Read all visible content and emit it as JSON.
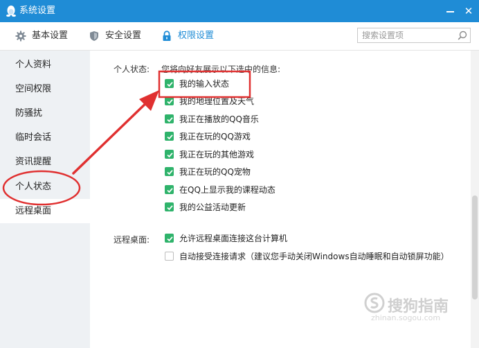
{
  "window": {
    "title": "系统设置",
    "min_icon": "minimize-icon",
    "close_glyph": "✕"
  },
  "tabs": [
    {
      "label": "基本设置",
      "icon": "gear-icon"
    },
    {
      "label": "安全设置",
      "icon": "shield-icon"
    },
    {
      "label": "权限设置",
      "icon": "lock-icon",
      "active": true
    }
  ],
  "search": {
    "placeholder": "搜索设置项",
    "value": ""
  },
  "sidebar": {
    "items": [
      {
        "label": "个人资料"
      },
      {
        "label": "空间权限"
      },
      {
        "label": "防骚扰"
      },
      {
        "label": "临时会话"
      },
      {
        "label": "资讯提醒"
      },
      {
        "label": "个人状态"
      },
      {
        "label": "远程桌面",
        "selected": true
      }
    ]
  },
  "personal_status": {
    "label": "个人状态:",
    "description": "您将向好友展示以下选中的信息:",
    "options": [
      {
        "label": "我的输入状态",
        "checked": true
      },
      {
        "label": "我的地理位置及天气",
        "checked": true
      },
      {
        "label": "我正在播放的QQ音乐",
        "checked": true
      },
      {
        "label": "我正在玩的QQ游戏",
        "checked": true
      },
      {
        "label": "我正在玩的其他游戏",
        "checked": true
      },
      {
        "label": "我正在玩的QQ宠物",
        "checked": true
      },
      {
        "label": "在QQ上显示我的课程动态",
        "checked": true
      },
      {
        "label": "我的公益活动更新",
        "checked": true
      }
    ]
  },
  "remote_desktop": {
    "label": "远程桌面:",
    "options": [
      {
        "label": "允许远程桌面连接这台计算机",
        "checked": true
      },
      {
        "label": "自动接受连接请求（建议您手动关闭Windows自动睡眠和自动锁屏功能）",
        "checked": false
      }
    ]
  },
  "colors": {
    "titlebar": "#1f8cd6",
    "accent": "#1f8cd6",
    "checkbox_checked": "#2fb36b",
    "annotation": "#e03030",
    "sidebar_bg": "#eef1f4"
  },
  "watermark": {
    "text": "搜狗指南",
    "url": "zhinan.sogou.com"
  }
}
